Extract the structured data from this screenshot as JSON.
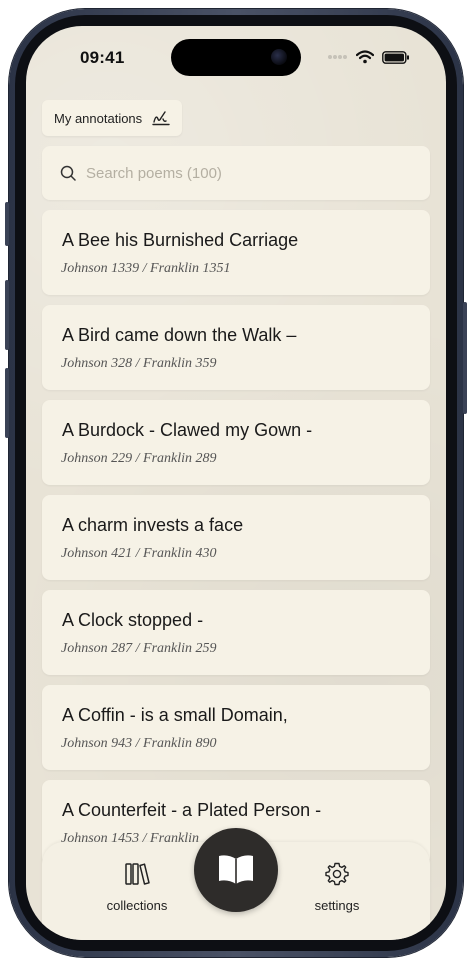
{
  "status": {
    "time": "09:41"
  },
  "annotations_button": {
    "label": "My annotations"
  },
  "search": {
    "placeholder": "Search poems (100)"
  },
  "poems": [
    {
      "title": "A Bee his Burnished Carriage",
      "ref": "Johnson 1339 / Franklin 1351"
    },
    {
      "title": "A Bird came down the Walk –",
      "ref": "Johnson 328 / Franklin 359"
    },
    {
      "title": "A Burdock - Clawed my Gown -",
      "ref": "Johnson 229 / Franklin 289"
    },
    {
      "title": "A charm invests a face",
      "ref": "Johnson 421 / Franklin 430"
    },
    {
      "title": "A Clock stopped -",
      "ref": "Johnson 287 / Franklin 259"
    },
    {
      "title": "A Coffin - is a small Domain,",
      "ref": "Johnson 943 / Franklin 890"
    },
    {
      "title": "A Counterfeit - a Plated Person -",
      "ref": "Johnson 1453 / Franklin"
    }
  ],
  "tabs": {
    "collections": "collections",
    "settings": "settings"
  },
  "colors": {
    "background": "#e8e3d6",
    "card": "#f6f2e6",
    "center_button": "#2e2c2a"
  }
}
